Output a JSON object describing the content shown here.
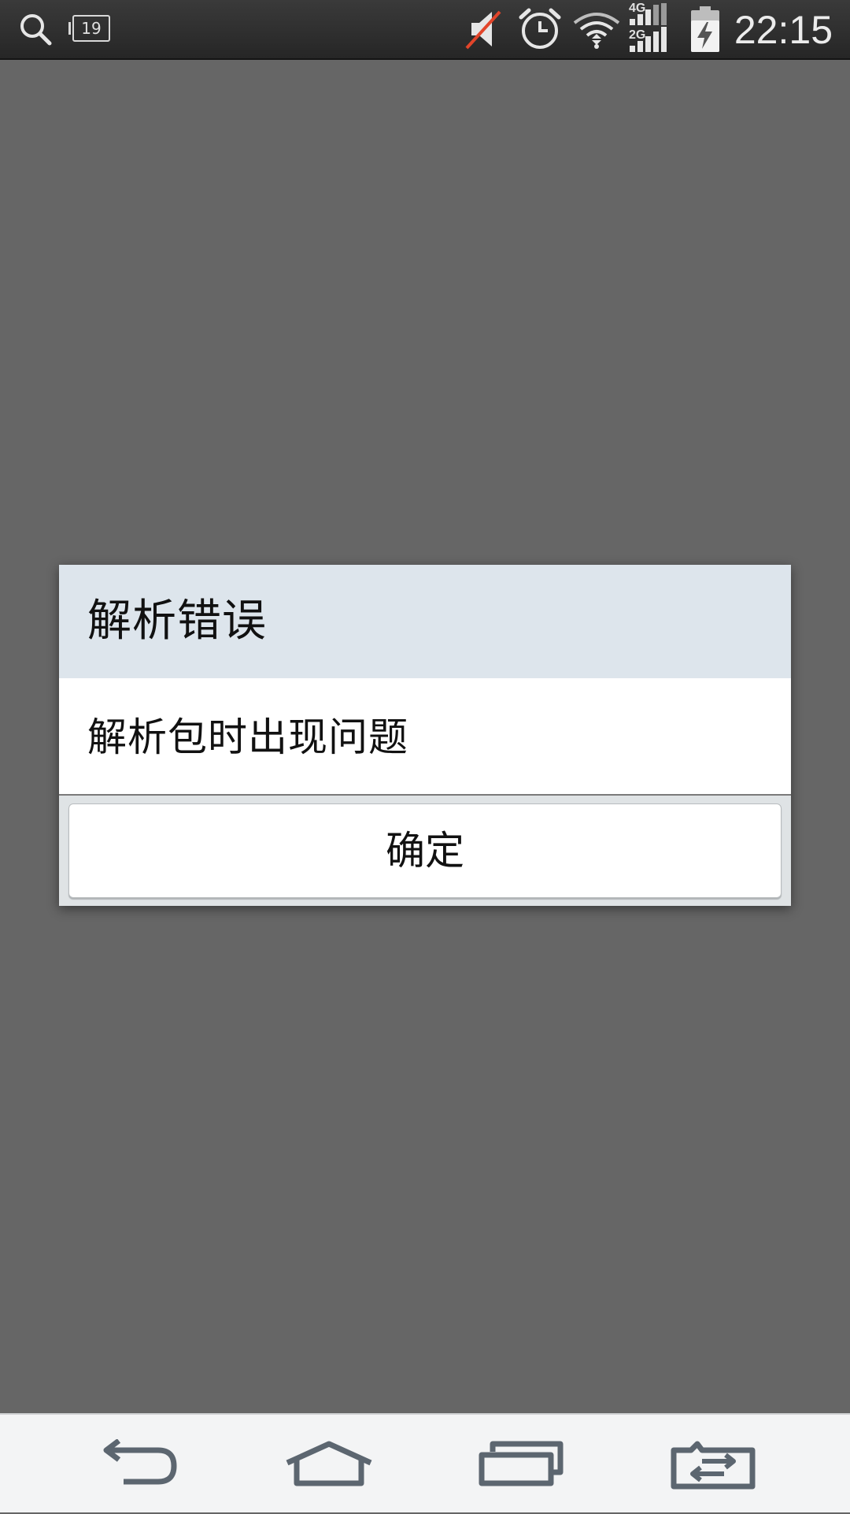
{
  "status_bar": {
    "calendar_day": "19",
    "network_top": "4G",
    "network_bottom": "2G",
    "time": "22:15",
    "icons": [
      "search-icon",
      "calendar-icon",
      "mute-icon",
      "alarm-icon",
      "wifi-icon",
      "signal-icon",
      "battery-charging-icon"
    ]
  },
  "dialog": {
    "title": "解析错误",
    "message": "解析包时出现问题",
    "ok_label": "确定"
  },
  "nav_bar": {
    "icons": [
      "back-icon",
      "home-icon",
      "recents-icon",
      "dual-window-icon"
    ]
  },
  "colors": {
    "scrim": "#666666",
    "dialog_header": "#dde5ec",
    "nav_icon": "#5c6670"
  }
}
